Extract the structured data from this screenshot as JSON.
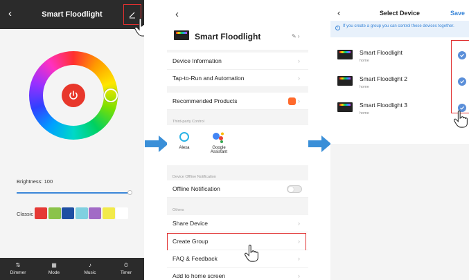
{
  "screen1": {
    "title": "Smart Floodlight",
    "brightness_label": "Brightness: 100",
    "brightness_level": 1.0,
    "classic_label": "Classic",
    "swatches": [
      "#e53935",
      "#8bc34a",
      "#1e4fa3",
      "#80d0e0",
      "#a26bc6",
      "#f2ea4a",
      "#ffffff"
    ],
    "tabs": [
      {
        "label": "Dimmer",
        "icon": "sliders-icon"
      },
      {
        "label": "Mode",
        "icon": "grid-icon"
      },
      {
        "label": "Music",
        "icon": "music-note-icon"
      },
      {
        "label": "Timer",
        "icon": "clock-icon"
      }
    ]
  },
  "screen2": {
    "device_name": "Smart Floodlight",
    "rows": {
      "device_info": "Device Information",
      "tap_to_run": "Tap-to-Run and Automation",
      "recommended": "Recommended Products",
      "offline_notification": "Offline Notification",
      "share_device": "Share Device",
      "create_group": "Create Group",
      "faq": "FAQ & Feedback",
      "add_home": "Add to home screen"
    },
    "sections": {
      "third_party": "Third-party Control",
      "offline": "Device Offline Notification",
      "others": "Others"
    },
    "third_party_items": {
      "alexa": "Alexa",
      "google": "Google Assistant"
    }
  },
  "screen3": {
    "title": "Select Device",
    "save_label": "Save",
    "info_text": "If you create a group you can control these devices together.",
    "devices": [
      {
        "name": "Smart Floodlight",
        "room": "home"
      },
      {
        "name": "Smart Floodlight 2",
        "room": "home"
      },
      {
        "name": "Smart Floodlight 3",
        "room": "home"
      }
    ]
  },
  "colors": {
    "accent": "#3a86d8",
    "highlight": "#e03030",
    "power": "#e8372b"
  }
}
